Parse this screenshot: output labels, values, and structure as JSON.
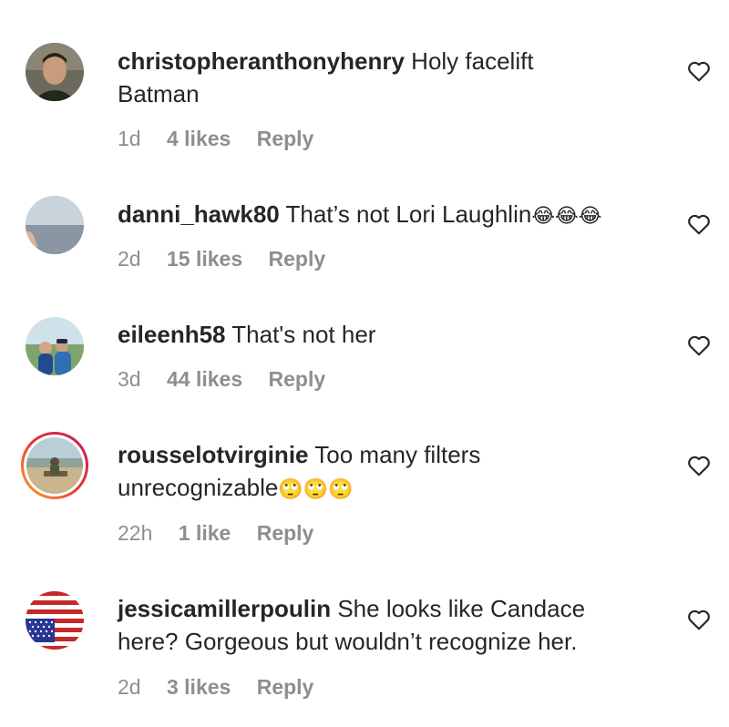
{
  "comments": [
    {
      "username": "christopheranthonyhenry",
      "text_line1": "Holy facelift",
      "text_line2": "Batman",
      "time": "1d",
      "likes": "4 likes",
      "reply": "Reply"
    },
    {
      "username": "danni_hawk80",
      "text_line1": "That’s not Lori Laughlin",
      "emoji": "😂😂😂",
      "time": "2d",
      "likes": "15 likes",
      "reply": "Reply"
    },
    {
      "username": "eileenh58",
      "text_line1": "That's not her",
      "time": "3d",
      "likes": "44 likes",
      "reply": "Reply"
    },
    {
      "username": "rousselotvirginie",
      "text_line1": "Too many filters",
      "text_line2": "unrecognizable",
      "emoji": "🙄🙄🙄",
      "time": "22h",
      "likes": "1 like",
      "reply": "Reply"
    },
    {
      "username": "jessicamillerpoulin",
      "text_line1": "She looks like Candace",
      "text_line2": "here? Gorgeous but wouldn’t recognize her.",
      "time": "2d",
      "likes": "3 likes",
      "reply": "Reply"
    }
  ],
  "icons": {
    "like": "heart-outline-icon"
  },
  "colors": {
    "text": "#262626",
    "meta": "#8e8e8e",
    "story_ring_start": "#f9a825",
    "story_ring_end": "#c2185b"
  }
}
